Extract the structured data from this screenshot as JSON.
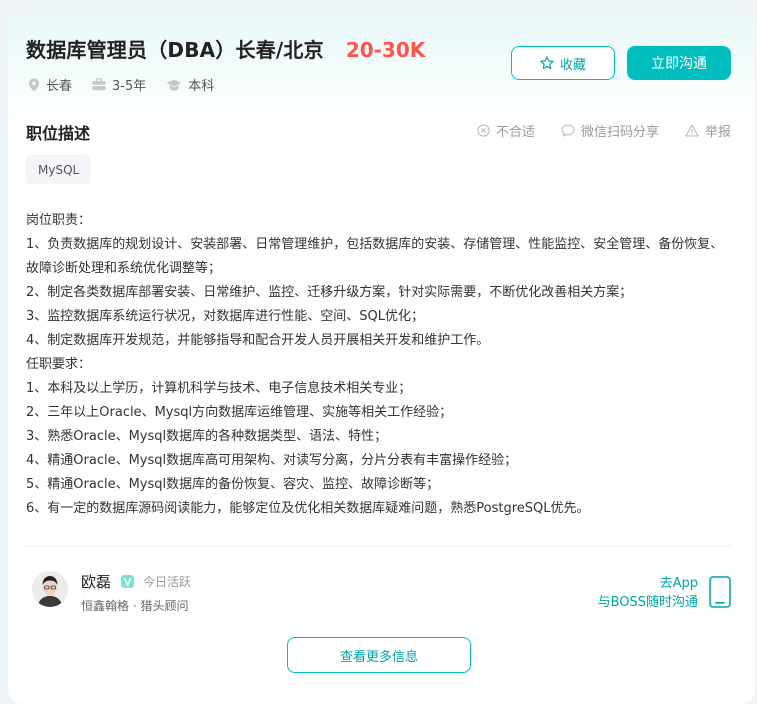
{
  "job": {
    "title": "数据库管理员（DBA）长春/北京",
    "salary": "20-30K",
    "location": "长春",
    "experience": "3-5年",
    "education": "本科"
  },
  "buttons": {
    "favorite": "收藏",
    "chat": "立即沟通",
    "more_info": "查看更多信息"
  },
  "section": {
    "title": "职位描述",
    "actions": {
      "not_suitable": "不合适",
      "wechat_share": "微信扫码分享",
      "report": "举报"
    }
  },
  "tags": [
    "MySQL"
  ],
  "description": [
    "岗位职责：",
    "1、负责数据库的规划设计、安装部署、日常管理维护，包括数据库的安装、存储管理、性能监控、安全管理、备份恢复、故障诊断处理和系统优化调整等；",
    "2、制定各类数据库部署安装、日常维护、监控、迁移升级方案，针对实际需要，不断优化改善相关方案；",
    "3、监控数据库系统运行状况，对数据库进行性能、空间、SQL优化；",
    "4、制定数据库开发规范，并能够指导和配合开发人员开展相关开发和维护工作。",
    "任职要求：",
    "1、本科及以上学历，计算机科学与技术、电子信息技术相关专业；",
    "2、三年以上Oracle、Mysql方向数据库运维管理、实施等相关工作经验；",
    "3、熟悉Oracle、Mysql数据库的各种数据类型、语法、特性；",
    "4、精通Oracle、Mysql数据库高可用架构、对读写分离，分片分表有丰富操作经验；",
    "5、精通Oracle、Mysql数据库的备份恢复、容灾、监控、故障诊断等；",
    "6、有一定的数据库源码阅读能力，能够定位及优化相关数据库疑难问题，熟悉PostgreSQL优先。"
  ],
  "recruiter": {
    "name": "欧磊",
    "status": "今日活跃",
    "company_role": "恒鑫翰格 · 猎头顾问"
  },
  "app_promo": {
    "line1": "去App",
    "line2": "与BOSS随时沟通"
  },
  "colors": {
    "accent": "#00bebd",
    "salary": "#fe574a"
  }
}
